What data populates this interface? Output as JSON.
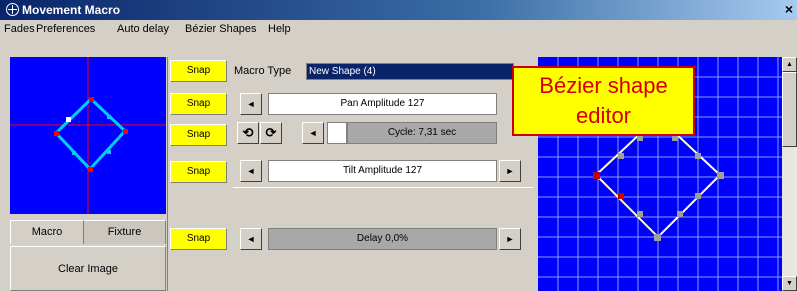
{
  "window": {
    "title": "Movement Macro",
    "close_glyph": "×"
  },
  "menu": [
    "Fades",
    "Preferences",
    "Auto delay",
    "Bézier Shapes",
    "Help"
  ],
  "tabs": {
    "macro": "Macro",
    "fixture": "Fixture"
  },
  "clear_image": "Clear Image",
  "snap_label": "Snap",
  "macro_type": {
    "label": "Macro Type",
    "value": "New Shape (4)"
  },
  "pan": {
    "label": "Pan Amplitude 127"
  },
  "cycle": {
    "label": "Cycle: 7,31 sec"
  },
  "tilt": {
    "label": "Tilt Amplitude 127"
  },
  "delay": {
    "label": "Delay 0,0%"
  },
  "callout": {
    "line1": "Bézier shape",
    "line2": "editor"
  },
  "icons": {
    "left_arrow": "◄",
    "right_arrow": "►",
    "rotate_ccw": "⟲",
    "rotate_cw": "⟳",
    "scroll_up": "▲",
    "scroll_down": "▼"
  },
  "colors": {
    "preview_bg": "#0000ff",
    "shape_stroke": "#00ccff",
    "bezier_stroke": "#ffffcc",
    "snap_bg": "#ffff00",
    "callout_border": "#cc0000",
    "callout_text": "#d40000"
  }
}
